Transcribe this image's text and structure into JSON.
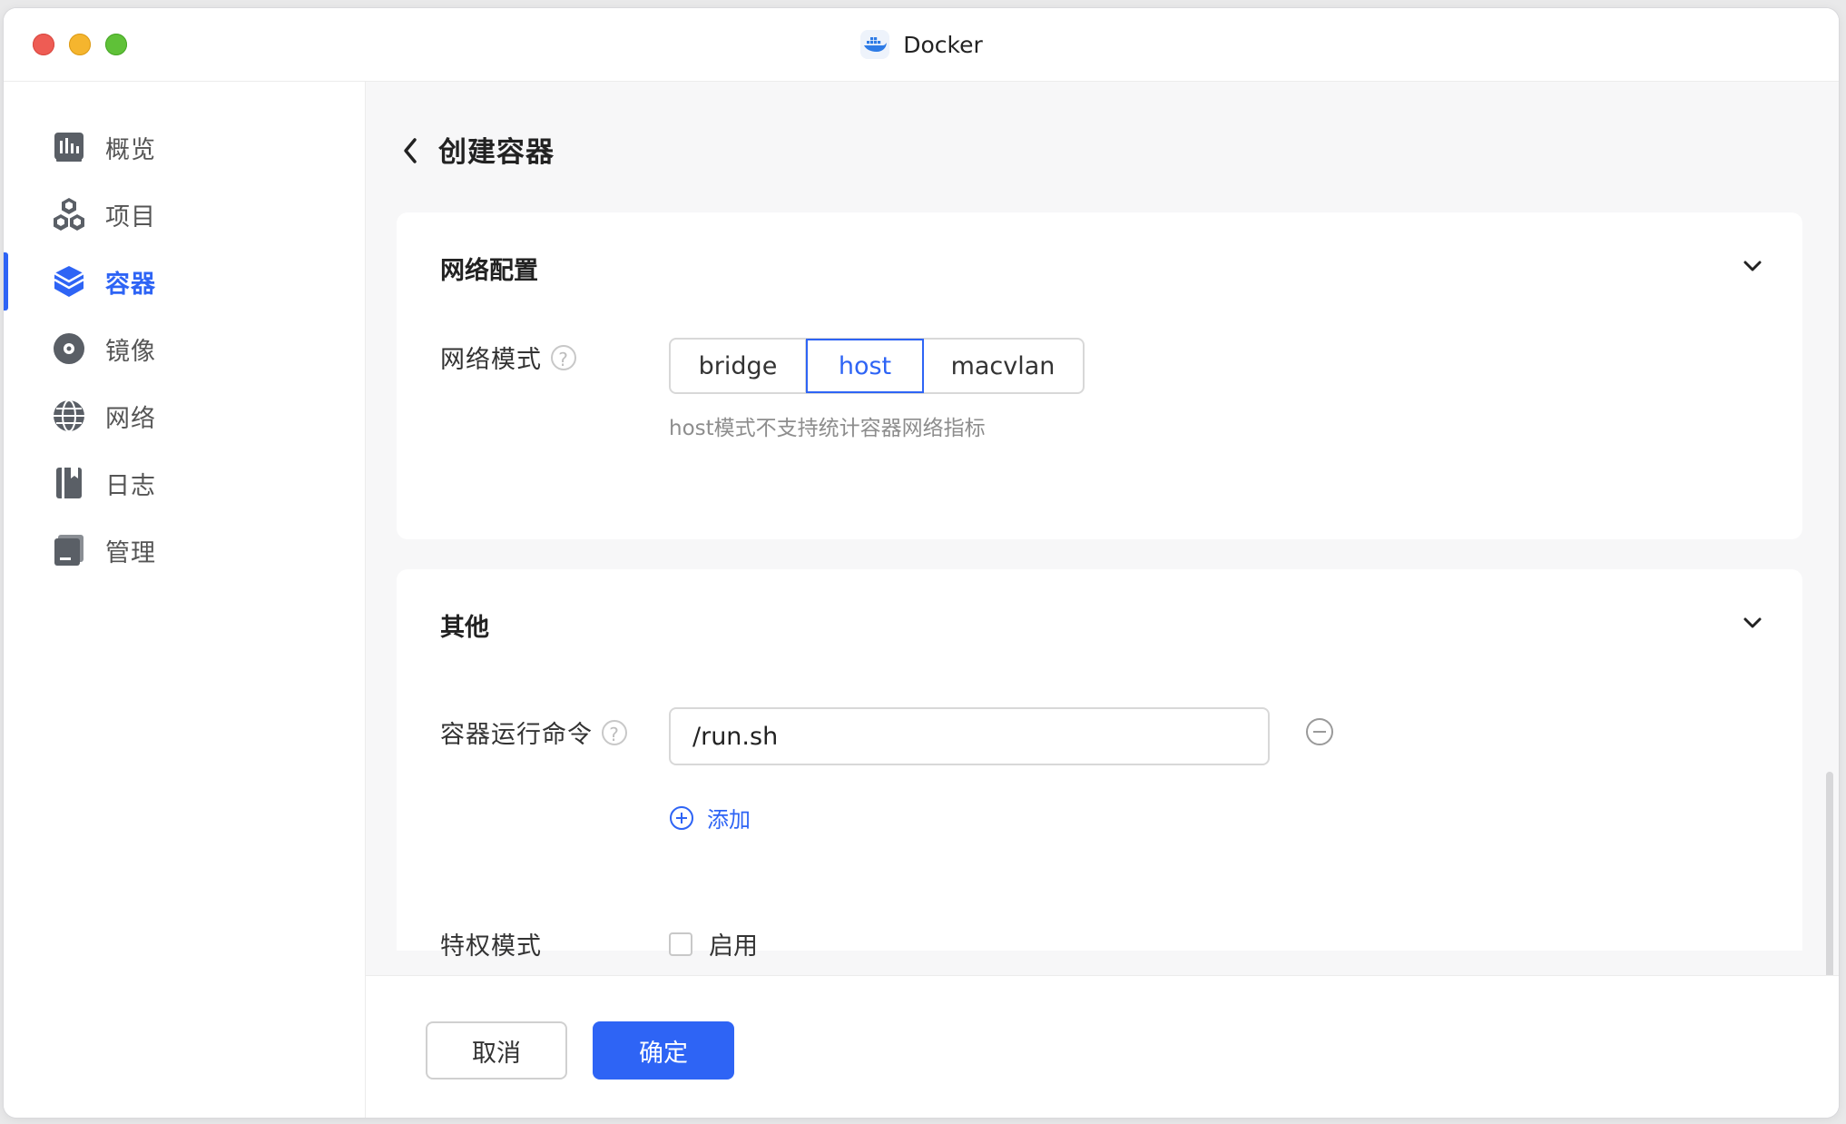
{
  "window": {
    "title": "Docker"
  },
  "sidebar": {
    "items": [
      {
        "label": "概览",
        "icon": "overview-icon",
        "active": false
      },
      {
        "label": "项目",
        "icon": "project-icon",
        "active": false
      },
      {
        "label": "容器",
        "icon": "container-icon",
        "active": true
      },
      {
        "label": "镜像",
        "icon": "image-icon",
        "active": false
      },
      {
        "label": "网络",
        "icon": "network-icon",
        "active": false
      },
      {
        "label": "日志",
        "icon": "log-icon",
        "active": false
      },
      {
        "label": "管理",
        "icon": "manage-icon",
        "active": false
      }
    ]
  },
  "page": {
    "title": "创建容器"
  },
  "network_section": {
    "title": "网络配置",
    "mode_label": "网络模式",
    "modes": [
      "bridge",
      "host",
      "macvlan"
    ],
    "selected_mode": "host",
    "hint": "host模式不支持统计容器网络指标"
  },
  "other_section": {
    "title": "其他",
    "command_label": "容器运行命令",
    "command_value": "/run.sh",
    "add_label": "添加",
    "privileged_label": "特权模式",
    "privileged_option": "启用",
    "privileged_checked": false
  },
  "footer": {
    "cancel_label": "取消",
    "ok_label": "确定"
  },
  "colors": {
    "accent": "#2e64f5",
    "close": "#ee5c54",
    "minimize": "#f5b52e",
    "maximize": "#5fc138"
  }
}
